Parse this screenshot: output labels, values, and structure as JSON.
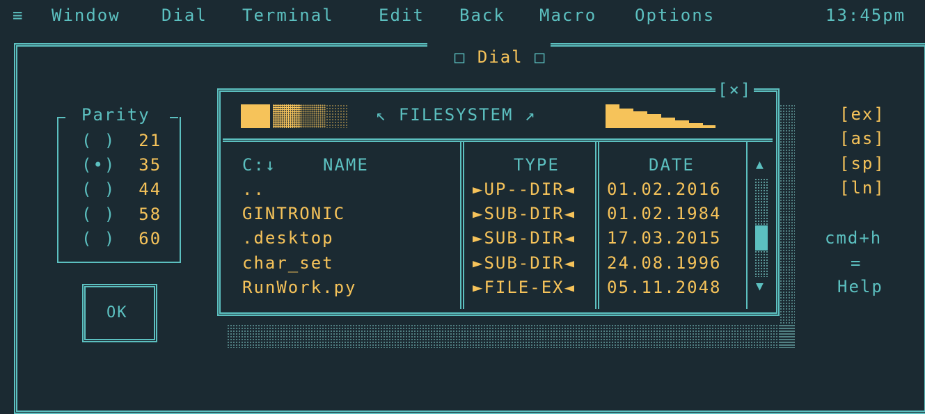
{
  "menu": {
    "hamburger": "≡",
    "items": [
      "Window",
      "Dial",
      "Terminal",
      "Edit",
      "Back",
      "Macro",
      "Options"
    ],
    "clock": "13:45pm"
  },
  "dial_window": {
    "title": "Dial",
    "parity": {
      "label": "Parity",
      "options": [
        {
          "mark": "( )",
          "value": "21"
        },
        {
          "mark": "(•)",
          "value": "35"
        },
        {
          "mark": "( )",
          "value": "44"
        },
        {
          "mark": "( )",
          "value": "58"
        },
        {
          "mark": "( )",
          "value": "60"
        }
      ],
      "selected": "35"
    },
    "ok_label": "OK",
    "shortcuts": [
      "[ex]",
      "[as]",
      "[sp]",
      "[ln]"
    ],
    "help": {
      "line1": "cmd+h",
      "line2": "=",
      "line3": "Help"
    }
  },
  "filesystem": {
    "close_label": "[×]",
    "title": "↖ FILESYSTEM ↗",
    "columns": {
      "drive": "C:↓",
      "name": "NAME",
      "type": "TYPE",
      "date": "DATE"
    },
    "rows": [
      {
        "name": "..",
        "type": "►UP--DIR◄",
        "date": "01.02.2016"
      },
      {
        "name": "GINTRONIC",
        "type": "►SUB-DIR◄",
        "date": "01.02.1984"
      },
      {
        "name": ".desktop",
        "type": "►SUB-DIR◄",
        "date": "17.03.2015"
      },
      {
        "name": "char_set",
        "type": "►SUB-DIR◄",
        "date": "24.08.1996"
      },
      {
        "name": "RunWork.py",
        "type": "►FILE-EX◄",
        "date": "05.11.2048"
      }
    ],
    "scroll_up": "▲",
    "scroll_down": "▼"
  },
  "colors": {
    "background": "#1b2a32",
    "accent": "#5cc0c0",
    "highlight": "#f6c35a"
  }
}
